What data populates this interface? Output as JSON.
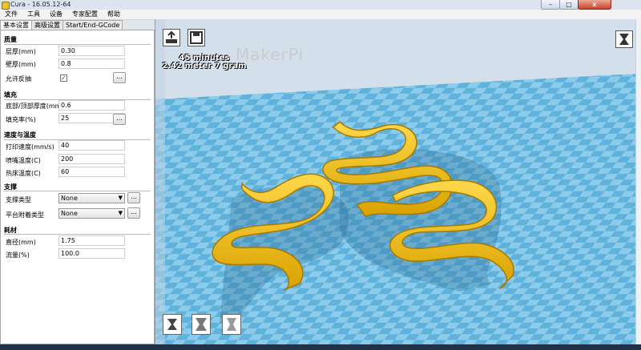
{
  "window": {
    "title": "Cura - 16.05.12-64",
    "close_label": "x",
    "min_label": "–",
    "max_label": "□"
  },
  "menu": [
    "文件",
    "工具",
    "设备",
    "专家配置",
    "帮助"
  ],
  "tabs": [
    "基本设置",
    "高级设置",
    "Start/End-GCode"
  ],
  "sections": {
    "quality": {
      "title": "质量",
      "fields": [
        {
          "label": "层厚(mm)",
          "value": "0.30"
        },
        {
          "label": "壁厚(mm)",
          "value": "0.8"
        }
      ],
      "retraction": {
        "label": "允许反抽",
        "checked": "✓",
        "more": "..."
      }
    },
    "fill": {
      "title": "填充",
      "fields": [
        {
          "label": "底部/顶部厚度(mm)",
          "value": "0.6"
        },
        {
          "label": "填充率(%)",
          "value": "25"
        }
      ],
      "more": "..."
    },
    "speed_temp": {
      "title": "速度与温度",
      "fields": [
        {
          "label": "打印速度(mm/s)",
          "value": "40"
        },
        {
          "label": "喷嘴温度(C)",
          "value": "200"
        },
        {
          "label": "热床温度(C)",
          "value": "60"
        }
      ]
    },
    "support": {
      "title": "支撑",
      "fields": [
        {
          "label": "支撑类型",
          "value": "None",
          "more": "..."
        },
        {
          "label": "平台附着类型",
          "value": "None",
          "more": "..."
        }
      ]
    },
    "filament": {
      "title": "耗材",
      "fields": [
        {
          "label": "直径(mm)",
          "value": "1.75"
        },
        {
          "label": "流量(%)",
          "value": "100.0"
        }
      ]
    }
  },
  "viewport": {
    "print_time": "45 minutes",
    "material": "2.42 meter 7 gram",
    "brand_text": "MakerPi",
    "bed_color": "#6bb8de",
    "model_color": "#f2c20e"
  }
}
